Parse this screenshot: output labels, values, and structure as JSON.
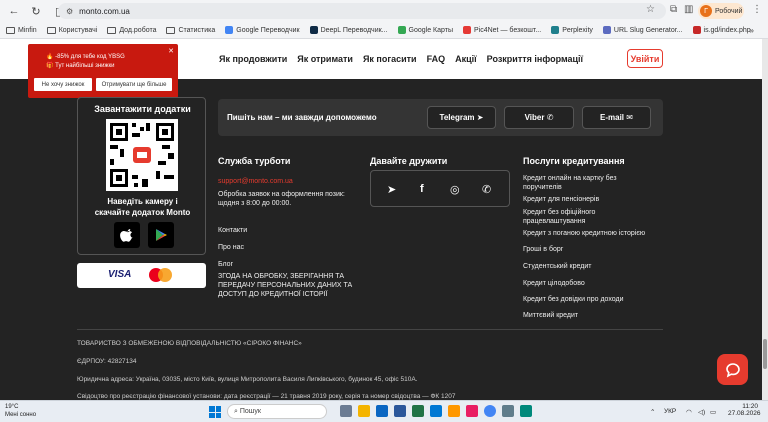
{
  "browser": {
    "url": "monto.com.ua",
    "profile_label": "Робочий",
    "profile_initial": "Г",
    "bookmarks": [
      {
        "label": "Minfin",
        "type": "folder"
      },
      {
        "label": "Користувачі",
        "type": "folder"
      },
      {
        "label": "Дод.робота",
        "type": "folder"
      },
      {
        "label": "Статистика",
        "type": "folder"
      },
      {
        "label": "Google Переводчик",
        "type": "site",
        "color": "#4285f4"
      },
      {
        "label": "DeepL Переводчик...",
        "type": "site",
        "color": "#0f2b46"
      },
      {
        "label": "Google Карты",
        "type": "site",
        "color": "#34a853"
      },
      {
        "label": "Pic4Net — безкошт...",
        "type": "site",
        "color": "#e53935"
      },
      {
        "label": "Perplexity",
        "type": "site",
        "color": "#20808d"
      },
      {
        "label": "URL Slug Generator...",
        "type": "site",
        "color": "#5c6bc0"
      },
      {
        "label": "is.gd/index.php",
        "type": "site",
        "color": "#c62828"
      }
    ],
    "more": "»"
  },
  "header": {
    "nav": [
      "Як продовжити",
      "Як отримати",
      "Як погасити",
      "FAQ",
      "Акції",
      "Розкриття інформації"
    ],
    "login": "Увійти"
  },
  "promo": {
    "line1": "🔥 -85% для тебе код YBSG",
    "line2": "🎁 Тут найбільші знижки",
    "decline": "Не хочу знижок",
    "accept": "Отримувати ще більше",
    "close": "✕"
  },
  "app": {
    "title": "Завантажити додатки",
    "hint_line1": "Наведіть камеру і",
    "hint_line2": "скачайте додаток Monto"
  },
  "payments": {
    "visa": "VISA"
  },
  "contact": {
    "text": "Пишіть нам – ми завжди допоможемо",
    "telegram": "Telegram",
    "viber": "Viber",
    "email": "E-mail"
  },
  "support": {
    "title": "Служба турботи",
    "email": "support@monto.com.ua",
    "hours_line1": "Обробка заявок на оформлення позик:",
    "hours_line2": "щодня з 8:00 до 00:00.",
    "links": [
      "Контакти",
      "Про нас",
      "Блог"
    ],
    "consent_line1": "ЗГОДА НА ОБРОБКУ, ЗБЕРІГАННЯ ТА",
    "consent_line2": "ПЕРЕДАЧУ ПЕРСОНАЛЬНИХ ДАНИХ ТА",
    "consent_line3": "ДОСТУП ДО КРЕДИТНОЇ ІСТОРІЇ"
  },
  "social": {
    "title": "Давайте дружити"
  },
  "services": {
    "title": "Послуги кредитування",
    "items": [
      [
        "Кредит онлайн на картку без",
        "поручителів"
      ],
      [
        "Кредит для пенсіонерів"
      ],
      [
        "Кредит без офіційного",
        "працевлаштування"
      ],
      [
        "Кредит з поганою кредитною історією"
      ],
      [
        "Гроші в борг"
      ],
      [
        "Студентський кредит"
      ],
      [
        "Кредит цілодобово"
      ],
      [
        "Кредит без довідки про доходи"
      ],
      [
        "Миттєвий кредит"
      ]
    ]
  },
  "legal": {
    "company": "ТОВАРИСТВО З ОБМЕЖЕНОЮ ВІДПОВІДАЛЬНІСТЮ «СІРОКО ФІНАНС»",
    "edrpou": "ЄДРПОУ: 42827134",
    "address": "Юридична адреса: Україна, 03035, місто Київ, вулиця Митрополита Василя Липківського, будинок 45, офіс 510А.",
    "certificate": "Свідоцтво про реєстрацію фінансової установи: дата реєстрації — 21 травня 2019 року, серія та номер свідоцтва — ФК 1207"
  },
  "taskbar": {
    "temp": "19°C",
    "weather": "Мені сонно",
    "search": "Пошук",
    "lang": "УКР",
    "time": "11:20",
    "date": "27.08.2026"
  },
  "colors": {
    "accent": "#e63b2e",
    "background": "#232323"
  }
}
